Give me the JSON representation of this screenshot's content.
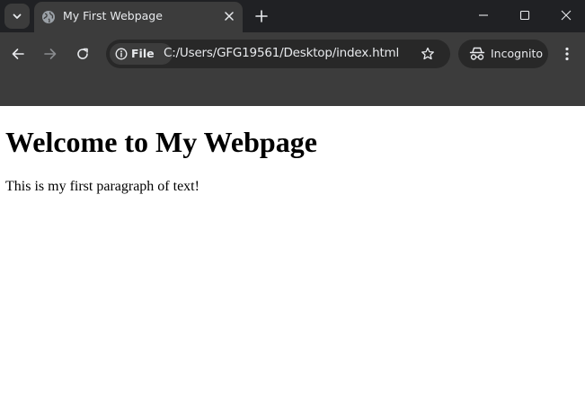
{
  "browser": {
    "tab": {
      "title": "My First Webpage",
      "favicon": "globe-icon"
    },
    "address_bar": {
      "site_chip_label": "File",
      "url": "C:/Users/GFG19561/Desktop/index.html"
    },
    "incognito_label": "Incognito",
    "icons": {
      "tab_search": "chevron-down-icon",
      "close_tab": "close-icon",
      "new_tab": "plus-icon",
      "minimize": "minimize-icon",
      "maximize": "maximize-icon",
      "close_window": "close-icon",
      "back": "arrow-left-icon",
      "forward": "arrow-right-icon",
      "reload": "reload-icon",
      "site_info": "info-icon",
      "bookmark": "star-icon",
      "incognito": "incognito-icon",
      "menu": "more-vertical-icon"
    },
    "colors": {
      "tabstrip": "#202124",
      "toolbar": "#3c3c3c",
      "omnibox": "#282828",
      "text": "#e8eaed"
    }
  },
  "page": {
    "heading": "Welcome to My Webpage",
    "paragraph": "This is my first paragraph of text!"
  }
}
